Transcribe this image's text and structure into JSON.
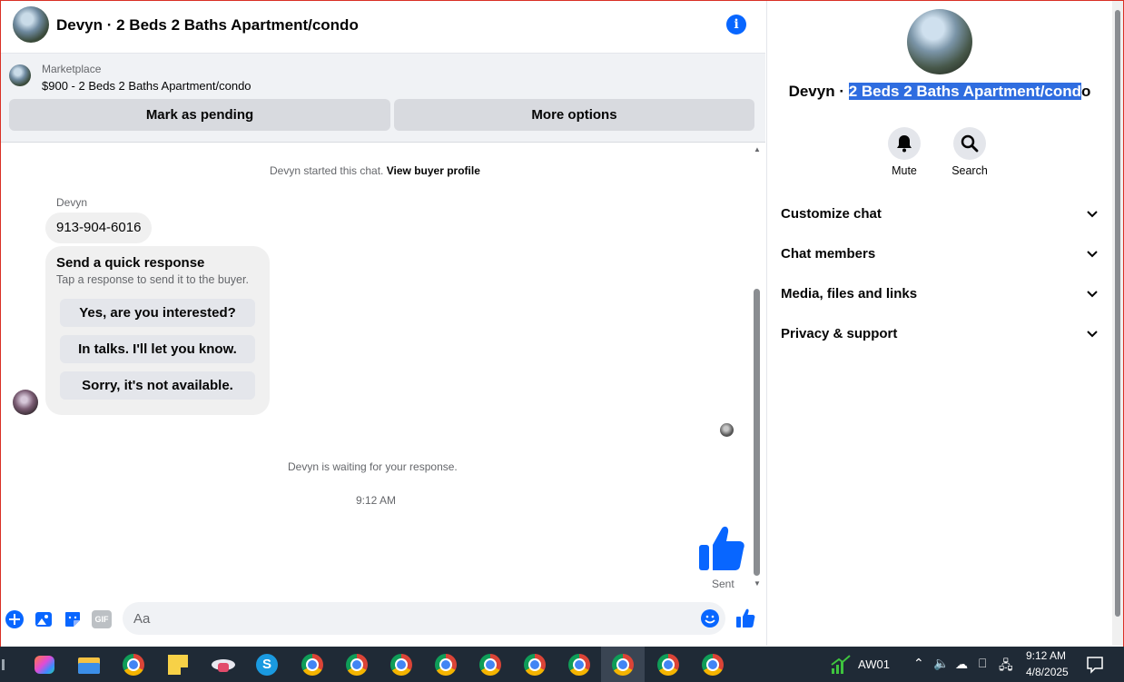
{
  "header": {
    "title": "Devyn · 2 Beds 2 Baths Apartment/condo"
  },
  "listing": {
    "category": "Marketplace",
    "price_title": "$900 - 2 Beds 2 Baths Apartment/condo",
    "mark_pending_label": "Mark as pending",
    "more_options_label": "More options"
  },
  "chat": {
    "started_text": "Devyn started this chat.",
    "view_profile_label": "View buyer profile",
    "sender_name": "Devyn",
    "phone_message": "913-904-6016",
    "quick_title": "Send a quick response",
    "quick_subtitle": "Tap a response to send it to the buyer.",
    "quick_responses": [
      "Yes, are you interested?",
      "In talks. I'll let you know.",
      "Sorry, it's not available."
    ],
    "waiting_text": "Devyn is waiting for your response.",
    "timestamp": "9:12 AM",
    "sent_label": "Sent"
  },
  "composer": {
    "placeholder": "Aa",
    "gif_label": "GIF"
  },
  "info_panel": {
    "name_prefix": "Devyn · ",
    "name_highlight": "2 Beds 2 Baths Apartment/cond",
    "name_suffix": "o",
    "mute_label": "Mute",
    "search_label": "Search",
    "sections": [
      "Customize chat",
      "Chat members",
      "Media, files and links",
      "Privacy & support"
    ]
  },
  "taskbar": {
    "tray_app_label": "AW01",
    "clock_time": "9:12 AM",
    "clock_date": "4/8/2025"
  },
  "colors": {
    "accent": "#0866ff",
    "highlight": "#2f6de0",
    "taskbar": "#1f2a36"
  }
}
